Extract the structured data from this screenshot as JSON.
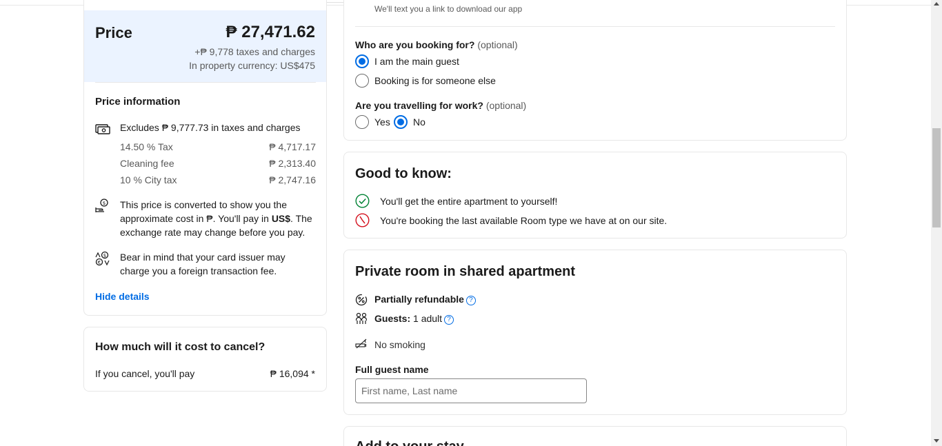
{
  "price": {
    "label": "Price",
    "amount": "₱ 27,471.62",
    "taxes": "+₱ 9,778 taxes and charges",
    "currency_note": "In property currency: US$475"
  },
  "price_info": {
    "title": "Price information",
    "excludes": "Excludes ₱ 9,777.73 in taxes and charges",
    "charges": [
      {
        "label": "14.50 % Tax",
        "value": "₱ 4,717.17"
      },
      {
        "label": "Cleaning fee",
        "value": "₱ 2,313.40"
      },
      {
        "label": "10 % City tax",
        "value": "₱ 2,747.16"
      }
    ],
    "conversion_pre": "This price is converted to show you the approximate cost in ₱. You'll pay in ",
    "conversion_currency": "US$",
    "conversion_post": ". The exchange rate may change before you pay.",
    "card_fee": "Bear in mind that your card issuer may charge you a foreign transaction fee.",
    "hide_details": "Hide details"
  },
  "cancel": {
    "title": "How much will it cost to cancel?",
    "label": "If you cancel, you'll pay",
    "value": "₱ 16,094 *"
  },
  "booking_form": {
    "app_note": "We'll text you a link to download our app",
    "booking_for": {
      "question": "Who are you booking for?",
      "optional": "(optional)",
      "options": [
        {
          "label": "I am the main guest",
          "selected": true
        },
        {
          "label": "Booking is for someone else",
          "selected": false
        }
      ]
    },
    "work_travel": {
      "question": "Are you travelling for work?",
      "optional": "(optional)",
      "options": [
        {
          "label": "Yes",
          "selected": false
        },
        {
          "label": "No",
          "selected": true
        }
      ]
    }
  },
  "good_to_know": {
    "title": "Good to know:",
    "items": [
      {
        "text": "You'll get the entire apartment to yourself!",
        "icon": "check-circle-icon",
        "color": "#008234"
      },
      {
        "text": "You're booking the last available Room type we have at on our site.",
        "icon": "clock-icon",
        "color": "#d4111e"
      }
    ]
  },
  "room": {
    "title": "Private room in shared apartment",
    "refundable": "Partially refundable",
    "guests_label": "Guests:",
    "guests_value": "1 adult",
    "smoking": "No smoking",
    "name_label": "Full guest name",
    "name_placeholder": "First name, Last name",
    "help_glyph": "?"
  },
  "add_to_stay": {
    "title": "Add to your stay"
  },
  "colors": {
    "accent": "#006ce4",
    "price_bg": "#ebf3ff",
    "success": "#008234",
    "danger": "#d4111e"
  }
}
